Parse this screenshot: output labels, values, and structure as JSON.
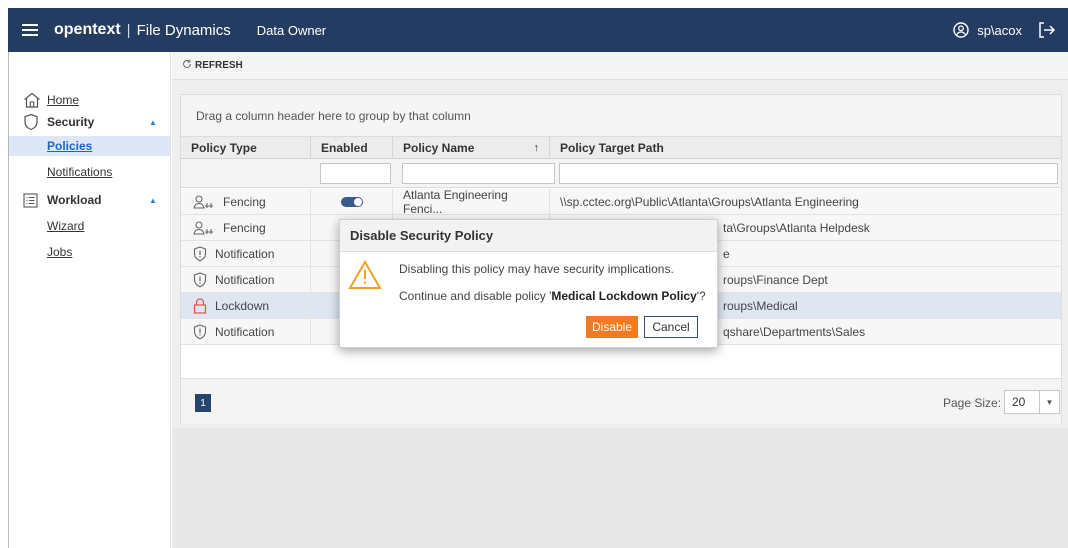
{
  "topbar": {
    "brand": "opentext",
    "brand_sep": "|",
    "product": "File Dynamics",
    "role": "Data Owner",
    "user": "sp\\acox"
  },
  "sidebar": {
    "home": "Home",
    "security": "Security",
    "policies": "Policies",
    "notifications": "Notifications",
    "workload": "Workload",
    "wizard": "Wizard",
    "jobs": "Jobs"
  },
  "toolbar": {
    "refresh": "REFRESH"
  },
  "grid": {
    "group_hint": "Drag a column header here to group by that column",
    "columns": [
      "Policy Type",
      "Enabled",
      "Policy Name",
      "Policy Target Path"
    ],
    "sort_indicator": "↑",
    "rows": [
      {
        "type": "Fencing",
        "icon": "fencing-icon",
        "name": "Atlanta Engineering Fenci...",
        "path": "\\\\sp.cctec.org\\Public\\Atlanta\\Groups\\Atlanta Engineering"
      },
      {
        "type": "Fencing",
        "icon": "fencing-icon",
        "name": "",
        "path": "ta\\Groups\\Atlanta Helpdesk"
      },
      {
        "type": "Notification",
        "icon": "shield-icon",
        "name": "",
        "path": "e"
      },
      {
        "type": "Notification",
        "icon": "shield-icon",
        "name": "",
        "path": "roups\\Finance Dept"
      },
      {
        "type": "Lockdown",
        "icon": "lock-icon",
        "name": "",
        "path": "roups\\Medical"
      },
      {
        "type": "Notification",
        "icon": "shield-icon",
        "name": "",
        "path": "qshare\\Departments\\Sales"
      }
    ],
    "selected_row": 4,
    "page": "1",
    "page_size_label": "Page Size:",
    "page_size": "20"
  },
  "dialog": {
    "title": "Disable Security Policy",
    "message1": "Disabling this policy may have security implications.",
    "message2_prefix": "Continue and disable policy '",
    "policy_name": "Medical Lockdown Policy",
    "message2_suffix": "'?",
    "disable_label": "Disable",
    "cancel_label": "Cancel"
  },
  "colors": {
    "topbar": "#243c61",
    "accent_orange": "#f07b22",
    "link_blue": "#1f66c3",
    "selected_row": "#dfe6f2"
  }
}
